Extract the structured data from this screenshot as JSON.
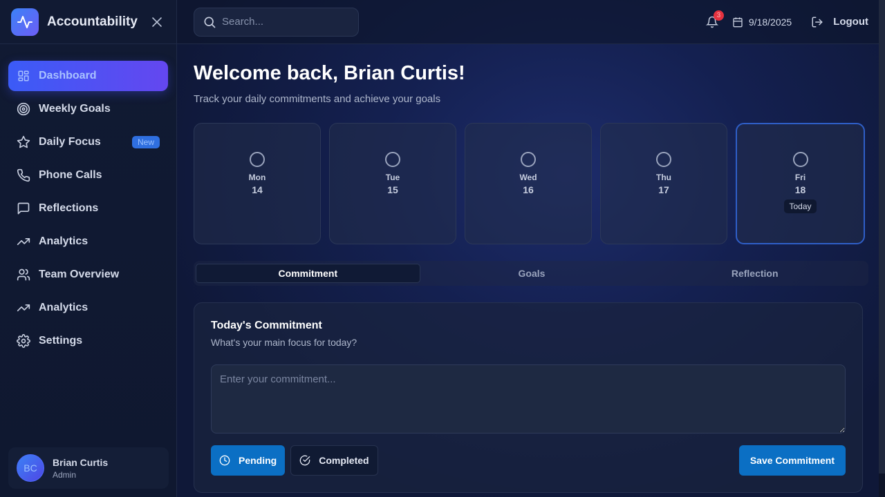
{
  "app": {
    "title": "Accountability"
  },
  "sidebar": {
    "items": [
      {
        "label": "Dashboard",
        "icon": "dashboard-icon",
        "active": true
      },
      {
        "label": "Weekly Goals",
        "icon": "target-icon"
      },
      {
        "label": "Daily Focus",
        "icon": "star-icon",
        "badge": "New"
      },
      {
        "label": "Phone Calls",
        "icon": "phone-icon"
      },
      {
        "label": "Reflections",
        "icon": "message-square-icon"
      },
      {
        "label": "Analytics",
        "icon": "trending-up-icon"
      },
      {
        "label": "Team Overview",
        "icon": "users-icon"
      },
      {
        "label": "Analytics",
        "icon": "trending-up-icon"
      },
      {
        "label": "Settings",
        "icon": "gear-icon"
      }
    ],
    "user": {
      "initials": "BC",
      "name": "Brian Curtis",
      "role": "Admin"
    }
  },
  "topbar": {
    "search_placeholder": "Search...",
    "notification_count": "3",
    "date": "9/18/2025",
    "logout_label": "Logout"
  },
  "main": {
    "welcome": "Welcome back, Brian Curtis!",
    "subtitle": "Track your daily commitments and achieve your goals",
    "days": [
      {
        "name": "Mon",
        "num": "14"
      },
      {
        "name": "Tue",
        "num": "15"
      },
      {
        "name": "Wed",
        "num": "16"
      },
      {
        "name": "Thu",
        "num": "17"
      },
      {
        "name": "Fri",
        "num": "18",
        "tag": "Today"
      }
    ],
    "tabs": [
      {
        "label": "Commitment",
        "active": true
      },
      {
        "label": "Goals"
      },
      {
        "label": "Reflection"
      }
    ],
    "card": {
      "title": "Today's Commitment",
      "subtitle": "What's your main focus for today?",
      "input_placeholder": "Enter your commitment...",
      "pending_label": "Pending",
      "completed_label": "Completed",
      "save_label": "Save Commitment"
    }
  },
  "colors": {
    "accent": "#3b5bf6",
    "primary_button": "#0b6fc4",
    "notification": "#e5323f"
  }
}
